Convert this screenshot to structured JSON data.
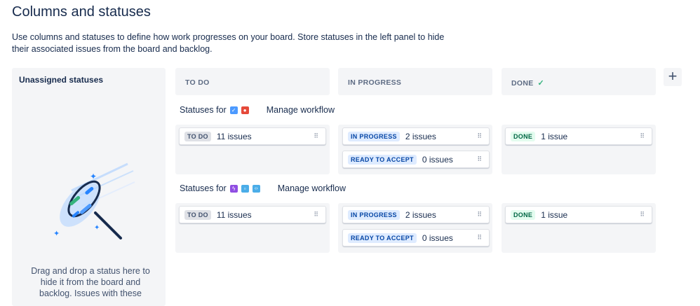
{
  "page": {
    "title": "Columns and statuses",
    "description": "Use columns and statuses to define how work progresses on your board. Store statuses in the left panel to hide their associated issues from the board and backlog."
  },
  "unassigned": {
    "title": "Unassigned statuses",
    "hint": "Drag and drop a status here to hide it from the board and backlog. Issues with these"
  },
  "columns": [
    {
      "label": "TO DO"
    },
    {
      "label": "IN PROGRESS"
    },
    {
      "label": "DONE",
      "icon": "check-icon"
    }
  ],
  "add_column_label": "+",
  "workflows": [
    {
      "statuses_for_label": "Statuses for",
      "manage_label": "Manage workflow",
      "type_icons": [
        {
          "name": "task-type-icon",
          "glyph": "✓",
          "color": "#4c9aff"
        },
        {
          "name": "bug-type-icon",
          "glyph": "●",
          "color": "#e5493a"
        }
      ],
      "cards": {
        "todo": [
          {
            "status": "TO DO",
            "count": "11 issues"
          }
        ],
        "in_progress": [
          {
            "status": "IN PROGRESS",
            "count": "2 issues"
          },
          {
            "status": "READY TO ACCEPT",
            "count": "0 issues"
          }
        ],
        "done": [
          {
            "status": "DONE",
            "count": "1 issue"
          }
        ]
      }
    },
    {
      "statuses_for_label": "Statuses for",
      "manage_label": "Manage workflow",
      "type_icons": [
        {
          "name": "epic-type-icon",
          "glyph": "ϟ",
          "color": "#904ee2"
        },
        {
          "name": "subtask-type-icon",
          "glyph": "▫",
          "color": "#4bade8"
        },
        {
          "name": "code-type-icon",
          "glyph": "‹›",
          "color": "#4bade8"
        }
      ],
      "cards": {
        "todo": [
          {
            "status": "TO DO",
            "count": "11 issues"
          }
        ],
        "in_progress": [
          {
            "status": "IN PROGRESS",
            "count": "2 issues"
          },
          {
            "status": "READY TO ACCEPT",
            "count": "0 issues"
          }
        ],
        "done": [
          {
            "status": "DONE",
            "count": "1 issue"
          }
        ]
      }
    }
  ],
  "colors": {
    "accent_blue": "#0052cc",
    "done_green": "#36b37e",
    "lane_bg": "#f4f5f7"
  }
}
